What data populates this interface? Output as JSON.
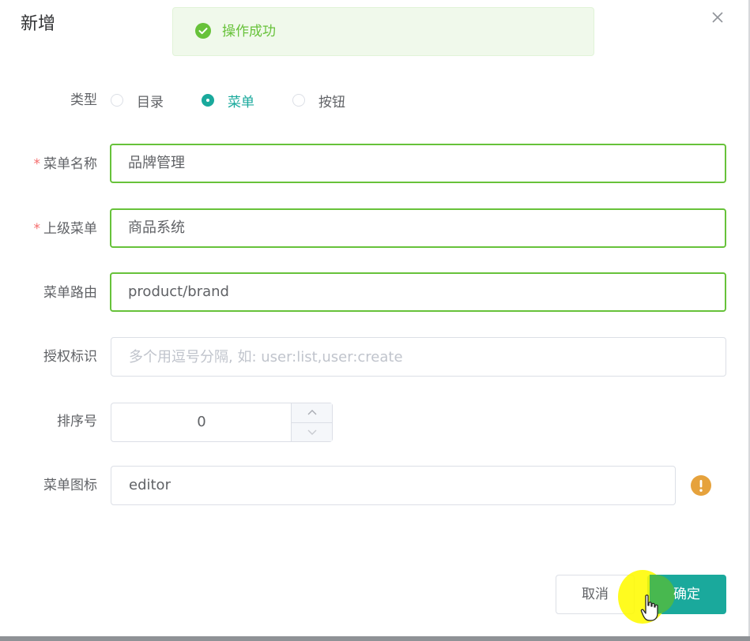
{
  "dialog": {
    "title": "新增",
    "close_icon": "close-icon"
  },
  "toast": {
    "message": "操作成功",
    "icon": "check-circle-icon",
    "color": "#67c23a"
  },
  "form": {
    "type": {
      "label": "类型",
      "options": [
        "目录",
        "菜单",
        "按钮"
      ],
      "selected": "菜单"
    },
    "menu_name": {
      "label": "菜单名称",
      "required_mark": "*",
      "value": "品牌管理"
    },
    "parent_menu": {
      "label": "上级菜单",
      "required_mark": "*",
      "value": "商品系统"
    },
    "route": {
      "label": "菜单路由",
      "value": "product/brand"
    },
    "permission": {
      "label": "授权标识",
      "value": "",
      "placeholder": "多个用逗号分隔, 如: user:list,user:create"
    },
    "order": {
      "label": "排序号",
      "value": "0"
    },
    "icon": {
      "label": "菜单图标",
      "value": "editor",
      "status_icon": "warning-icon"
    }
  },
  "footer": {
    "cancel_label": "取消",
    "confirm_label": "确定"
  },
  "colors": {
    "primary": "#1aa99c",
    "success": "#67c23a",
    "warning": "#e6a23c",
    "required": "#f56c6c"
  }
}
